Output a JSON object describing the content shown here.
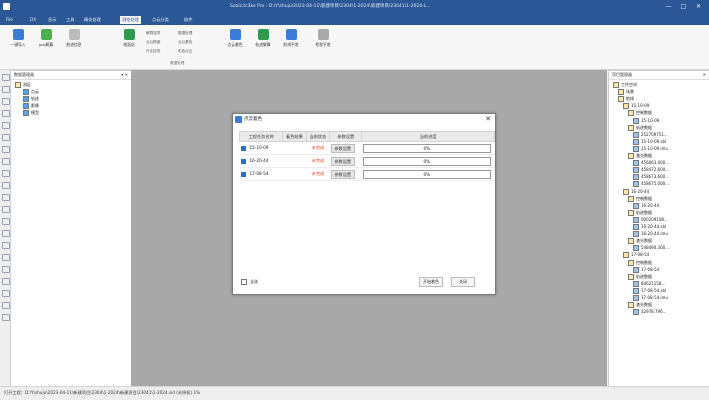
{
  "window": {
    "title": "Soaiz.tc3ke Pro - D:\\Y\\shuju\\2023-04-11\\新建项目\\2304\\1-2024\\新建项目\\23041\\1-2024-L...",
    "controls": [
      "—",
      "□",
      "✕"
    ]
  },
  "menu": [
    "File",
    "DX",
    "显示",
    "工具",
    "精化处理",
    "测绘处理",
    "点云分类",
    "插件"
  ],
  "menu_active_index": 5,
  "ribbon": {
    "buttons": [
      {
        "label": "一键导入",
        "icon": "import-icon",
        "color": "#3a7bd5"
      },
      {
        "label": "pos解算",
        "icon": "pos-solve-icon",
        "color": "#4caf50"
      },
      {
        "label": "航迹信息",
        "icon": "track-info-icon",
        "color": "#777777"
      },
      {
        "label": "地面站",
        "icon": "ground-station-icon",
        "color": "#2e9b4f"
      },
      {
        "label": "点云着色",
        "icon": "colorize-icon",
        "color": "#3a7bd5"
      },
      {
        "label": "轨迹解算",
        "icon": "solve-icon",
        "color": "#2e9b4f"
      },
      {
        "label": "航线平差",
        "icon": "adjust-icon",
        "color": "#3a7bd5"
      },
      {
        "label": "检校平差",
        "icon": "calib-icon",
        "color": "#888888"
      }
    ],
    "options": [
      "解算选项",
      "点云精度",
      "外业检查",
      "数据处理",
      "点云着色",
      "彩色点云"
    ],
    "group_label": "数据处理"
  },
  "left_panel": {
    "title": "数据管理器",
    "pin": "▾ ✕",
    "tree": [
      {
        "label": "测区",
        "indent": 0
      },
      {
        "label": "点云",
        "indent": 1
      },
      {
        "label": "轨迹",
        "indent": 1
      },
      {
        "label": "影像",
        "indent": 1
      },
      {
        "label": "模型",
        "indent": 1
      }
    ]
  },
  "right_panel": {
    "title": "项目管理器",
    "pin": "✕",
    "tree": [
      {
        "label": "工作空间",
        "indent": 0
      },
      {
        "label": "场景",
        "indent": 1
      },
      {
        "label": "航线",
        "indent": 1
      },
      {
        "label": "15-10-09",
        "indent": 2
      },
      {
        "label": "控制数据",
        "indent": 3
      },
      {
        "label": "15-10-09",
        "indent": 4
      },
      {
        "label": "轨迹数据",
        "indent": 3
      },
      {
        "label": "252709751...",
        "indent": 4
      },
      {
        "label": "15-10-09.sbl",
        "indent": 4
      },
      {
        "label": "15-10-09.imu",
        "indent": 4
      },
      {
        "label": "激光数据",
        "indent": 3
      },
      {
        "label": "456063.400...",
        "indent": 4
      },
      {
        "label": "458472.600...",
        "indent": 4
      },
      {
        "label": "458673.600...",
        "indent": 4
      },
      {
        "label": "458675.000...",
        "indent": 4
      },
      {
        "label": "16-20-44",
        "indent": 2
      },
      {
        "label": "控制数据",
        "indent": 3
      },
      {
        "label": "16-20-44",
        "indent": 4
      },
      {
        "label": "轨迹数据",
        "indent": 3
      },
      {
        "label": "000209108...",
        "indent": 4
      },
      {
        "label": "16-20-44.sbl",
        "indent": 4
      },
      {
        "label": "16-20-44.imu",
        "indent": 4
      },
      {
        "label": "激光数据",
        "indent": 3
      },
      {
        "label": "548490.300...",
        "indent": 4
      },
      {
        "label": "17-08-54",
        "indent": 2
      },
      {
        "label": "控制数据",
        "indent": 3
      },
      {
        "label": "17-08-54",
        "indent": 4
      },
      {
        "label": "轨迹数据",
        "indent": 3
      },
      {
        "label": "84621158...",
        "indent": 4
      },
      {
        "label": "17-08-54.sbl",
        "indent": 4
      },
      {
        "label": "17-08-54.imu",
        "indent": 4
      },
      {
        "label": "激光数据",
        "indent": 3
      },
      {
        "label": "32978.796...",
        "indent": 4
      }
    ]
  },
  "dialog": {
    "title": "点云着色",
    "close": "✕",
    "columns": [
      "工程任务名称",
      "着色结果",
      "当前状态",
      "参数设置",
      "当前进度"
    ],
    "rows": [
      {
        "name": "15-10-09",
        "status": "未完成",
        "settings": "参数设置",
        "progress": "0%"
      },
      {
        "name": "16-20-44",
        "status": "未完成",
        "settings": "参数设置",
        "progress": "0%"
      },
      {
        "name": "17-08-54",
        "status": "未完成",
        "settings": "参数设置",
        "progress": "0%"
      }
    ],
    "select_all": "全选",
    "start": "开始着色",
    "cancel": "关闭"
  },
  "status": "打开工程：D:\\Y\\shuju\\2023-04-11\\新建项目\\2304\\1-2024\\新建项目\\23041\\1-2024.sid (未授权) 1%"
}
